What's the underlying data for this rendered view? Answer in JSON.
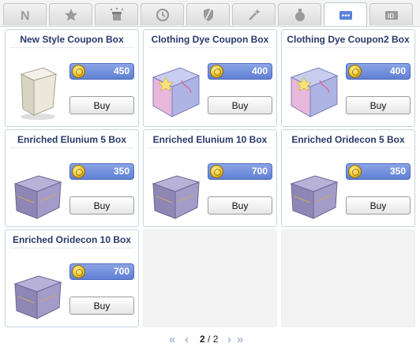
{
  "tabs": [
    {
      "name": "tab-new",
      "icon": "n-letter-icon",
      "glyph": "N",
      "active": false
    },
    {
      "name": "tab-favorites",
      "icon": "star-icon",
      "active": false
    },
    {
      "name": "tab-events",
      "icon": "sparkle-box-icon",
      "active": false
    },
    {
      "name": "tab-rental",
      "icon": "clock-icon",
      "active": false
    },
    {
      "name": "tab-equipment",
      "icon": "shield-icon",
      "active": false
    },
    {
      "name": "tab-consumables",
      "icon": "magic-wand-icon",
      "active": false
    },
    {
      "name": "tab-potions",
      "icon": "potion-icon",
      "active": false
    },
    {
      "name": "tab-other",
      "icon": "ellipsis-box-icon",
      "active": true
    },
    {
      "name": "tab-special",
      "icon": "id-card-icon",
      "active": false
    }
  ],
  "items": [
    {
      "title": "New Style Coupon Box",
      "price": "450",
      "buy_label": "Buy",
      "image": "white-coupon-box"
    },
    {
      "title": "Clothing Dye Coupon Box",
      "price": "400",
      "buy_label": "Buy",
      "image": "dye-chest"
    },
    {
      "title": "Clothing Dye Coupon2 Box",
      "price": "400",
      "buy_label": "Buy",
      "image": "dye-chest"
    },
    {
      "title": "Enriched Elunium 5 Box",
      "price": "350",
      "buy_label": "Buy",
      "image": "purple-box"
    },
    {
      "title": "Enriched Elunium 10 Box",
      "price": "700",
      "buy_label": "Buy",
      "image": "purple-box"
    },
    {
      "title": "Enriched Oridecon 5 Box",
      "price": "350",
      "buy_label": "Buy",
      "image": "purple-box"
    },
    {
      "title": "Enriched Oridecon 10 Box",
      "price": "700",
      "buy_label": "Buy",
      "image": "purple-box"
    }
  ],
  "pager": {
    "current": "2",
    "separator": " / ",
    "total": "2"
  },
  "colors": {
    "title": "#283a6b",
    "price_bar": "#6f8de0",
    "coin": "#f1c52a",
    "page_arrows": "#a8b4cc"
  }
}
